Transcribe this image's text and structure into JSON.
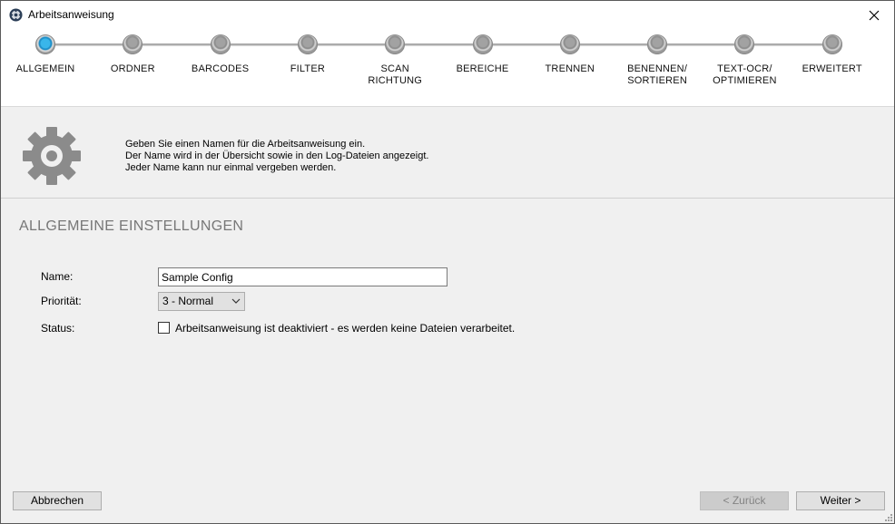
{
  "window": {
    "title": "Arbeitsanweisung"
  },
  "steps": [
    {
      "label": "ALLGEMEIN",
      "active": true
    },
    {
      "label": "ORDNER",
      "active": false
    },
    {
      "label": "BARCODES",
      "active": false
    },
    {
      "label": "FILTER",
      "active": false
    },
    {
      "label": "SCAN\nRICHTUNG",
      "active": false
    },
    {
      "label": "BEREICHE",
      "active": false
    },
    {
      "label": "TRENNEN",
      "active": false
    },
    {
      "label": "BENENNEN/\nSORTIEREN",
      "active": false
    },
    {
      "label": "TEXT-OCR/\nOPTIMIEREN",
      "active": false
    },
    {
      "label": "ERWEITERT",
      "active": false
    }
  ],
  "info": {
    "line1": "Geben Sie einen Namen für die Arbeitsanweisung ein.",
    "line2": "Der Name wird in der Übersicht sowie in den Log-Dateien angezeigt.",
    "line3": "Jeder Name kann nur einmal vergeben werden."
  },
  "section": {
    "title": "ALLGEMEINE EINSTELLUNGEN"
  },
  "form": {
    "name_label": "Name:",
    "name_value": "Sample Config",
    "priority_label": "Priorität:",
    "priority_value": "3 - Normal",
    "status_label": "Status:",
    "status_checkbox_text": "Arbeitsanweisung ist deaktiviert - es werden keine Dateien verarbeitet.",
    "status_checked": false
  },
  "buttons": {
    "cancel": "Abbrechen",
    "back": "< Zurück",
    "next": "Weiter >"
  }
}
